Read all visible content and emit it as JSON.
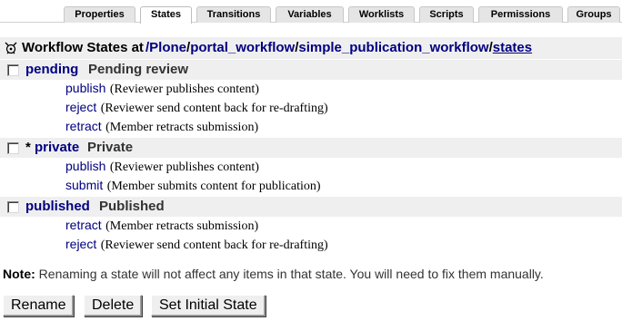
{
  "tabs": [
    {
      "label": "Properties",
      "active": false
    },
    {
      "label": "States",
      "active": true
    },
    {
      "label": "Transitions",
      "active": false
    },
    {
      "label": "Variables",
      "active": false
    },
    {
      "label": "Worklists",
      "active": false
    },
    {
      "label": "Scripts",
      "active": false
    },
    {
      "label": "Permissions",
      "active": false
    },
    {
      "label": "Groups",
      "active": false
    }
  ],
  "header": {
    "icon": "workflow-icon",
    "title": "Workflow States at",
    "path": [
      "/Plone",
      "portal_workflow",
      "simple_publication_workflow",
      "states"
    ],
    "separator": "/"
  },
  "states": [
    {
      "id": "pending",
      "initial_marker": "",
      "title": "Pending review",
      "transitions": [
        {
          "id": "publish",
          "desc": "(Reviewer publishes content)"
        },
        {
          "id": "reject",
          "desc": "(Reviewer send content back for re-drafting)"
        },
        {
          "id": "retract",
          "desc": "(Member retracts submission)"
        }
      ]
    },
    {
      "id": "private",
      "initial_marker": "*",
      "title": "Private",
      "transitions": [
        {
          "id": "publish",
          "desc": "(Reviewer publishes content)"
        },
        {
          "id": "submit",
          "desc": "(Member submits content for publication)"
        }
      ]
    },
    {
      "id": "published",
      "initial_marker": "",
      "title": "Published",
      "transitions": [
        {
          "id": "retract",
          "desc": "(Member retracts submission)"
        },
        {
          "id": "reject",
          "desc": "(Reviewer send content back for re-drafting)"
        }
      ]
    }
  ],
  "note": {
    "label": "Note:",
    "text": "Renaming a state will not affect any items in that state. You will need to fix them manually."
  },
  "buttons": {
    "rename": "Rename",
    "delete": "Delete",
    "set_initial": "Set Initial State"
  },
  "colors": {
    "link": "#000080",
    "row_background": "#efefef",
    "tab_background": "#e5e5e5"
  }
}
